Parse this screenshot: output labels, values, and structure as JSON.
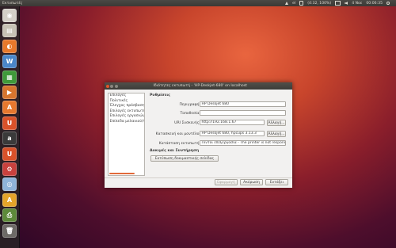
{
  "top_panel": {
    "app_title": "Εκτυπωτές",
    "tray": {
      "keyboard": "el",
      "battery": "(4:32, 100%)",
      "date": "4 Νοε",
      "time": "00:06:35"
    }
  },
  "launcher": {
    "items": [
      {
        "icon": "dash-home-icon",
        "color": "#d4d0c8",
        "glyph": "◉",
        "active": false
      },
      {
        "icon": "files-icon",
        "color": "#c7c2b5",
        "glyph": "▤",
        "active": false
      },
      {
        "icon": "firefox-icon",
        "color": "#e7792b",
        "glyph": "◐",
        "active": false
      },
      {
        "icon": "writer-icon",
        "color": "#4a86c8",
        "glyph": "W",
        "active": false
      },
      {
        "icon": "calc-icon",
        "color": "#3f9a3a",
        "glyph": "▦",
        "active": false
      },
      {
        "icon": "impress-icon",
        "color": "#d7752e",
        "glyph": "▶",
        "active": false
      },
      {
        "icon": "software-center-icon",
        "color": "#e6782e",
        "glyph": "A",
        "active": false
      },
      {
        "icon": "ubuntu-one-icon",
        "color": "#d9522a",
        "glyph": "U",
        "active": false
      },
      {
        "icon": "amazon-icon",
        "color": "#3a3a3a",
        "glyph": "a",
        "active": false
      },
      {
        "icon": "ubuntu-one-music-icon",
        "color": "#d9522a",
        "glyph": "U",
        "active": false
      },
      {
        "icon": "system-settings-icon",
        "color": "#c8413d",
        "glyph": "⚙",
        "active": false
      },
      {
        "icon": "chrome-icon",
        "color": "#8fb4d8",
        "glyph": "◎",
        "active": false
      },
      {
        "icon": "update-manager-icon",
        "color": "#e4a52a",
        "glyph": "A",
        "active": false
      },
      {
        "icon": "printers-icon",
        "color": "#5d8a3a",
        "glyph": "⎙",
        "active": true
      },
      {
        "icon": "trash-icon",
        "color": "#6d6a66",
        "glyph": "🗑",
        "active": false
      }
    ]
  },
  "dialog": {
    "title": "Ιδιότητες εκτυπωτή - 'HP-Deskjet-680' on localhost",
    "sidebar": [
      "Επιλογές",
      "Πολιτικές",
      "Έλεγχος πρόσβασης",
      "Επιλογές εκτυπωτή",
      "Επιλογές εργασιών",
      "Επίπεδα μελανιού/τόνερ"
    ],
    "section_settings": "Ρυθμίσεις",
    "fields": {
      "description": {
        "label": "Περιγραφή:",
        "value": "HP Deskjet 680"
      },
      "location": {
        "label": "Τοποθεσία:",
        "value": ""
      },
      "uri": {
        "label": "URI Συσκευής:",
        "value": "http://192.168.1.67",
        "button": "Αλλαγή..."
      },
      "make_model": {
        "label": "Κατασκευή και μοντέλο:",
        "value": "HP Deskjet 680, hpcups 3.13.3",
        "button": "Αλλαγή..."
      },
      "state": {
        "label": "Κατάσταση εκτυπωτή:",
        "value": "Πιντοι επεξεργασία - The printer is not responding."
      }
    },
    "section_tests": "Δοκιμές και Συντήρηση",
    "test_page_button": "Εκτύπωση δοκιμαστικής σελίδας",
    "apply_button": "Εφαρμογή",
    "cancel_button": "Ακύρωση",
    "ok_button": "Εντάξει"
  }
}
